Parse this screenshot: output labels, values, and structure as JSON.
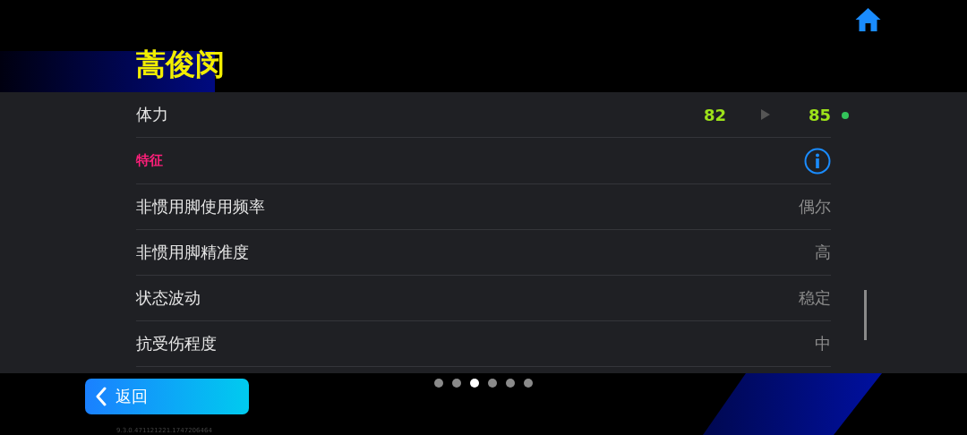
{
  "title": "蒿俊闵",
  "stat": {
    "label": "体力",
    "current": "82",
    "next": "85"
  },
  "section": {
    "title": "特征"
  },
  "traits": [
    {
      "label": "非惯用脚使用频率",
      "value": "偶尔"
    },
    {
      "label": "非惯用脚精准度",
      "value": "高"
    },
    {
      "label": "状态波动",
      "value": "稳定"
    },
    {
      "label": "抗受伤程度",
      "value": "中"
    }
  ],
  "pager": [
    {
      "selected": false
    },
    {
      "selected": false
    },
    {
      "selected": true
    },
    {
      "selected": false
    },
    {
      "selected": false
    },
    {
      "selected": false
    }
  ],
  "back_button": {
    "label": "返回"
  },
  "version": "9.3.0.471121221.1747206464"
}
